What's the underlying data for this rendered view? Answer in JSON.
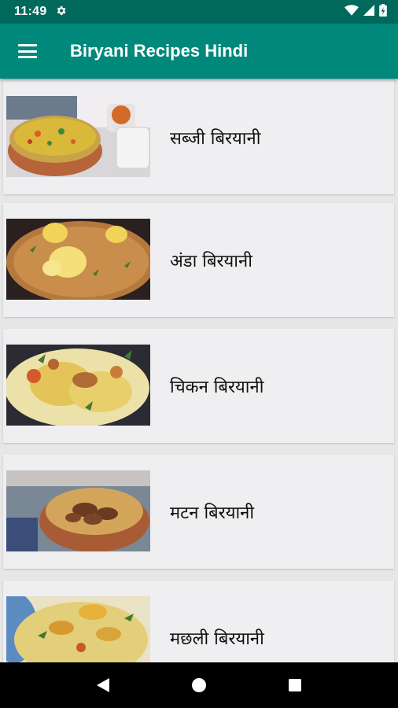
{
  "status_bar": {
    "time": "11:49",
    "icons": [
      "gear-icon",
      "wifi-icon",
      "signal-icon",
      "battery-icon"
    ]
  },
  "app_bar": {
    "title": "Biryani Recipes Hindi",
    "menu_icon": "hamburger-menu-icon"
  },
  "recipes": [
    {
      "label": "सब्जी बिरयानी"
    },
    {
      "label": "अंडा बिरयानी"
    },
    {
      "label": "चिकन बिरयानी"
    },
    {
      "label": "मटन बिरयानी"
    },
    {
      "label": "मछली बिरयानी"
    }
  ],
  "nav_bar": {
    "icons": [
      "back-icon",
      "home-icon",
      "recents-icon"
    ]
  },
  "colors": {
    "status_bar": "#00695c",
    "app_bar": "#00897b",
    "background": "#e7e7e7",
    "card": "#efeff1"
  }
}
